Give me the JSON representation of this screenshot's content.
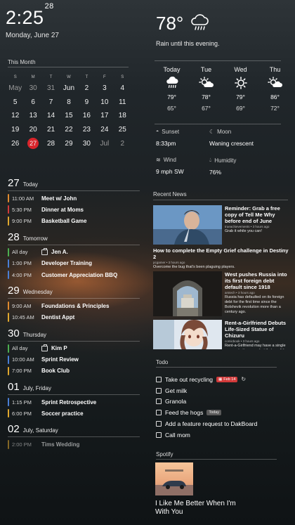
{
  "clock": {
    "time": "2:25",
    "seconds": "28",
    "date": "Monday, June 27"
  },
  "calendar": {
    "title": "This Month",
    "dow": [
      "S",
      "M",
      "T",
      "W",
      "T",
      "F",
      "S"
    ],
    "weeks": [
      [
        "May",
        "30",
        "31",
        "Jun",
        "2",
        "3",
        "4"
      ],
      [
        "5",
        "6",
        "7",
        "8",
        "9",
        "10",
        "11"
      ],
      [
        "12",
        "13",
        "14",
        "15",
        "16",
        "17",
        "18"
      ],
      [
        "19",
        "20",
        "21",
        "22",
        "23",
        "24",
        "25"
      ],
      [
        "26",
        "27",
        "28",
        "29",
        "30",
        "Jul",
        "2"
      ]
    ],
    "today": "27"
  },
  "agenda": [
    {
      "num": "27",
      "label": "Today",
      "events": [
        {
          "time": "11:00 AM",
          "name": "Meet w/ John",
          "color": "#e08a2e"
        },
        {
          "time": "5:30 PM",
          "name": "Dinner at Moms",
          "color": "#d23a3a"
        },
        {
          "time": "9:00 PM",
          "name": "Basketball Game",
          "color": "#e0a82e"
        }
      ]
    },
    {
      "num": "28",
      "label": "Tomorrow",
      "events": [
        {
          "time": "All day",
          "name": "Jen A.",
          "color": "#4caf50",
          "person": true
        },
        {
          "time": "1:00 PM",
          "name": "Developer Training",
          "color": "#4a7fd6"
        },
        {
          "time": "4:00 PM",
          "name": "Customer Appreciation BBQ",
          "color": "#4a7fd6"
        }
      ]
    },
    {
      "num": "29",
      "label": "Wednesday",
      "events": [
        {
          "time": "9:00 AM",
          "name": "Foundations & Principles",
          "color": "#e08a2e"
        },
        {
          "time": "10:45 AM",
          "name": "Dentist Appt",
          "color": "#e0a82e"
        }
      ]
    },
    {
      "num": "30",
      "label": "Thursday",
      "events": [
        {
          "time": "All day",
          "name": "Kim P",
          "color": "#4caf50",
          "person": true
        },
        {
          "time": "10:00 AM",
          "name": "Sprint Review",
          "color": "#4a7fd6"
        },
        {
          "time": "7:00 PM",
          "name": "Book Club",
          "color": "#e0a82e"
        }
      ]
    },
    {
      "num": "01",
      "label": "July, Friday",
      "events": [
        {
          "time": "1:15 PM",
          "name": "Sprint Retrospective",
          "color": "#4a7fd6"
        },
        {
          "time": "6:00 PM",
          "name": "Soccer practice",
          "color": "#e0a82e"
        }
      ]
    },
    {
      "num": "02",
      "label": "July, Saturday",
      "events": [
        {
          "time": "2:00 PM",
          "name": "Tims Wedding",
          "color": "#e0a82e"
        }
      ]
    }
  ],
  "weather": {
    "temp": "78°",
    "summary": "Rain until this evening.",
    "forecast": [
      {
        "day": "Today",
        "icon": "rain-icon",
        "hi": "79°",
        "lo": "65°"
      },
      {
        "day": "Tue",
        "icon": "partly-sunny-icon",
        "hi": "78°",
        "lo": "67°"
      },
      {
        "day": "Wed",
        "icon": "sun-icon",
        "hi": "79°",
        "lo": "69°"
      },
      {
        "day": "Thu",
        "icon": "partly-sunny-icon",
        "hi": "86°",
        "lo": "72°"
      }
    ],
    "sunset_label": "Sunset",
    "sunset": "8:33pm",
    "moon_label": "Moon",
    "moon": "Waning crescent",
    "wind_label": "Wind",
    "wind": "9 mph SW",
    "humidity_label": "Humidity",
    "humidity": "76%"
  },
  "news": {
    "title": "Recent News",
    "items": [
      {
        "headline": "Reminder: Grab a free copy of Tell Me Why before end of June",
        "source": "trueachievements  •  3 hours ago",
        "summary": "Grab it while you can!"
      },
      {
        "headline": "How to complete the Empty Grief challenge in Destiny 2",
        "source": "pcgamer  •  3 hours ago",
        "summary": "Overcome the bug that's been plaguing players."
      },
      {
        "headline": "West pushes Russia into its first foreign debt default since 1918",
        "source": "arstech  •  3 hours ago",
        "summary": "Russia has defaulted on its foreign debt for the first time since the Bolshevik revolution more than a century ago."
      },
      {
        "headline": "Rent-a-Girlfriend Debuts Life-Sized Statue of Chizuru",
        "source": "comicbook  •  3 hours ago",
        "summary": "Rent-a-Girlfriend may have a single season to its name, but that won't be"
      }
    ]
  },
  "todo": {
    "title": "Todo",
    "items": [
      {
        "text": "Take out recycling",
        "badge": "Feb 14",
        "badge_style": "red",
        "repeat": true
      },
      {
        "text": "Get milk"
      },
      {
        "text": "Granola"
      },
      {
        "text": "Feed the hogs",
        "badge": "Today",
        "badge_style": "grey"
      },
      {
        "text": "Add a feature request to DakBoard"
      },
      {
        "text": "Call mom"
      }
    ]
  },
  "spotify": {
    "title": "Spotify",
    "song": "I Like Me Better When I'm With You"
  }
}
